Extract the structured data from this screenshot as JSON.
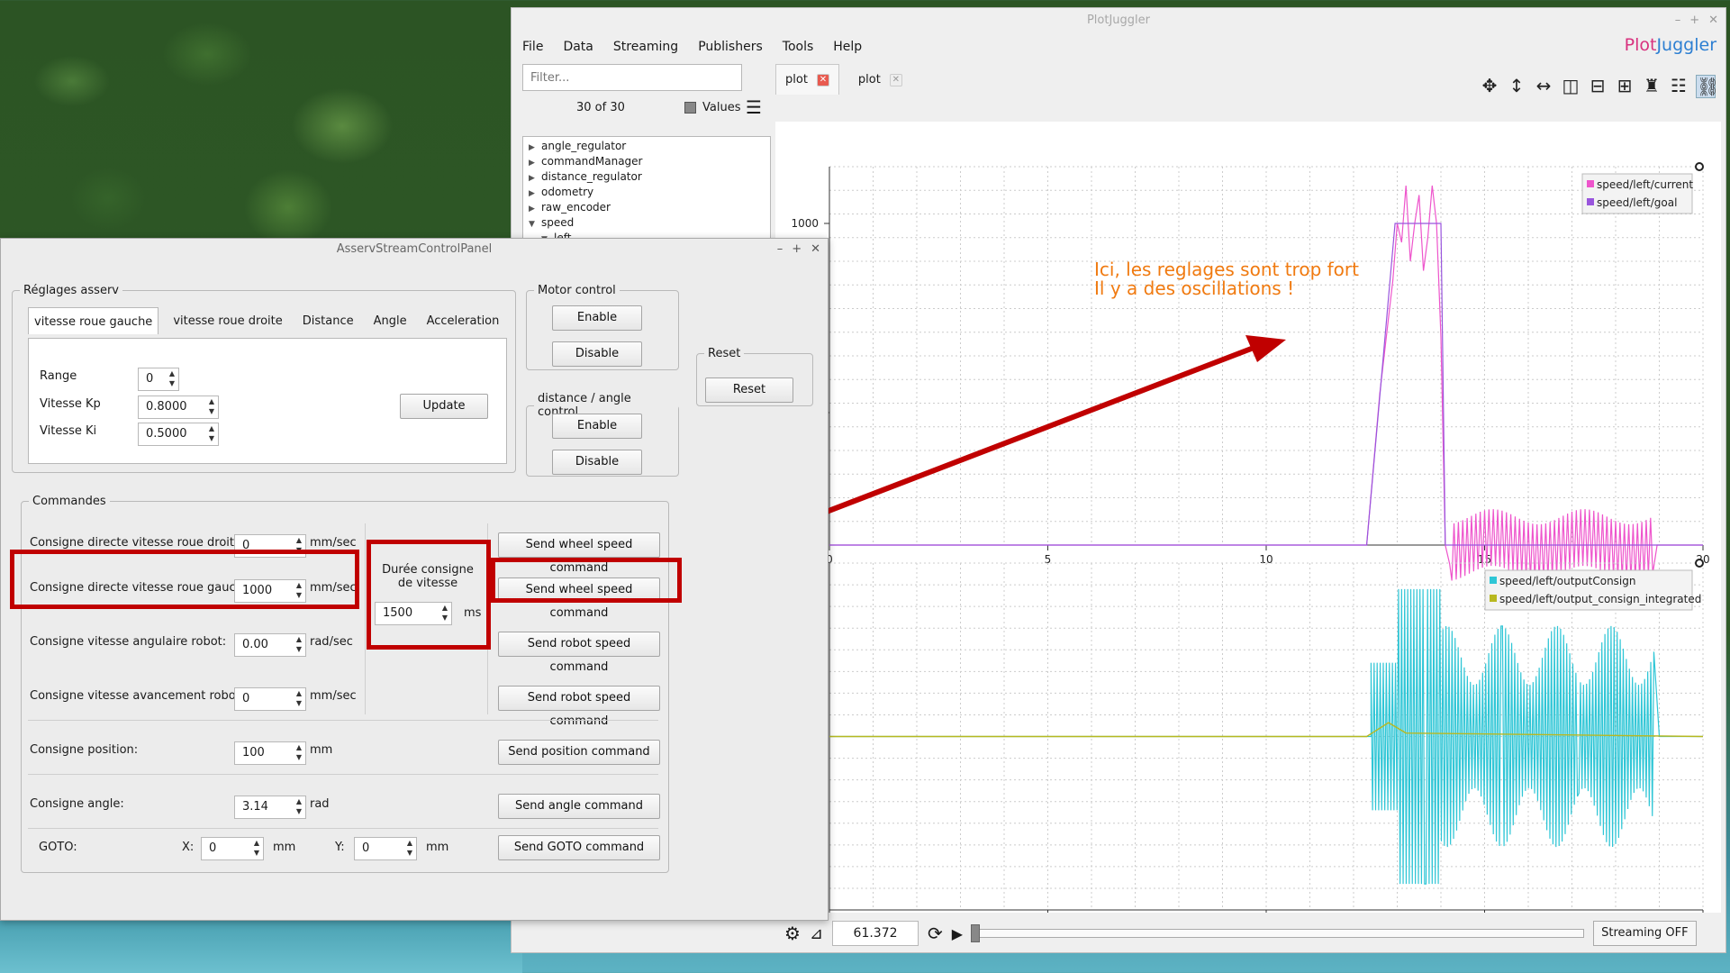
{
  "pj": {
    "title": "PlotJuggler",
    "brand_a": "Plot",
    "brand_b": "Juggler",
    "menu": [
      "File",
      "Data",
      "Streaming",
      "Publishers",
      "Tools",
      "Help"
    ],
    "filter_placeholder": "Filter...",
    "count": "30 of 30",
    "values_label": "Values",
    "tree": [
      {
        "label": "angle_regulator",
        "open": false
      },
      {
        "label": "commandManager",
        "open": false
      },
      {
        "label": "distance_regulator",
        "open": false
      },
      {
        "label": "odometry",
        "open": false
      },
      {
        "label": "raw_encoder",
        "open": false
      },
      {
        "label": "speed",
        "open": true
      },
      {
        "label": "left",
        "open": true
      }
    ],
    "tabs": [
      "plot",
      "plot"
    ],
    "time": "61.372",
    "streaming": "Streaming OFF"
  },
  "colors": {
    "pink": "#ee55cc",
    "violet": "#9955dd",
    "cyan": "#2fc6d6",
    "olive": "#b8b820",
    "annotation": "#f07a10",
    "red": "#c00000"
  },
  "annotation": {
    "line1": "Ici, les reglages sont trop fort",
    "line2": "Il y a des oscillations !"
  },
  "chart_data": [
    {
      "type": "line",
      "xlim": [
        0,
        20
      ],
      "ylim": [
        660,
        1060
      ],
      "xticks": [
        0,
        5,
        10,
        15,
        20
      ],
      "yticks": [
        800,
        1000
      ],
      "grid": true,
      "legend": "top-right",
      "series": [
        {
          "name": "speed/left/current",
          "color": "#ee55cc",
          "x": [
            0,
            12.3,
            12.6,
            12.9,
            13.0,
            13.1,
            13.2,
            13.3,
            13.4,
            13.5,
            13.6,
            13.7,
            13.8,
            13.9,
            14.0,
            14.1,
            14.2,
            14.3,
            14.6,
            15,
            15.5,
            16,
            16.5,
            17,
            17.5,
            18,
            18.5,
            19
          ],
          "y": [
            660,
            660,
            820,
            940,
            1000,
            980,
            1040,
            960,
            1000,
            1030,
            950,
            985,
            1040,
            1000,
            880,
            660,
            640,
            680,
            640,
            680,
            640,
            680,
            640,
            680,
            640,
            680,
            640,
            660
          ]
        },
        {
          "name": "speed/left/goal",
          "color": "#9955dd",
          "x": [
            0,
            12.3,
            12.95,
            13.05,
            14.0,
            14.1,
            20
          ],
          "y": [
            660,
            660,
            1000,
            1000,
            1000,
            660,
            660
          ]
        }
      ]
    },
    {
      "type": "line",
      "xlim": [
        0,
        20
      ],
      "ylim": [
        -1,
        1
      ],
      "xticks": [
        0,
        5,
        10,
        15,
        20
      ],
      "grid": true,
      "legend": "top-right",
      "series": [
        {
          "name": "speed/left/outputConsign",
          "color": "#2fc6d6"
        },
        {
          "name": "speed/left/output_consign_integrated",
          "color": "#b8b820"
        }
      ]
    }
  ],
  "cp": {
    "title": "AsservStreamControlPanel",
    "reglages": "Réglages asserv",
    "tabs": [
      "vitesse roue gauche",
      "vitesse roue droite",
      "Distance",
      "Angle",
      "Acceleration"
    ],
    "range_label": "Range",
    "range_val": "0",
    "kp_label": "Vitesse Kp",
    "kp_val": "0.8000",
    "ki_label": "Vitesse Ki",
    "ki_val": "0.5000",
    "update": "Update",
    "motor": "Motor control",
    "enable": "Enable",
    "disable": "Disable",
    "distangle": "distance / angle control",
    "reset_group": "Reset",
    "reset": "Reset",
    "commandes": "Commandes",
    "rows": [
      {
        "label": "Consigne directe vitesse roue droite:",
        "val": "0",
        "unit": "mm/sec",
        "btn": "Send wheel speed command"
      },
      {
        "label": "Consigne directe vitesse roue gauche:",
        "val": "1000",
        "unit": "mm/sec",
        "btn": "Send wheel speed command"
      },
      {
        "label": "Consigne vitesse angulaire robot:",
        "val": "0.00",
        "unit": "rad/sec",
        "btn": "Send robot speed command"
      },
      {
        "label": "Consigne vitesse avancement robot:",
        "val": "0",
        "unit": "mm/sec",
        "btn": "Send robot speed command"
      },
      {
        "label": "Consigne position:",
        "val": "100",
        "unit": "mm",
        "btn": "Send position command"
      },
      {
        "label": "Consigne angle:",
        "val": "3.14",
        "unit": "rad",
        "btn": "Send angle command"
      }
    ],
    "duree": "Durée consigne de vitesse",
    "duree_val": "1500",
    "duree_unit": "ms",
    "goto": "GOTO:",
    "x_label": "X:",
    "x_val": "0",
    "y_label": "Y:",
    "y_val": "0",
    "mm": "mm",
    "goto_btn": "Send GOTO command"
  }
}
